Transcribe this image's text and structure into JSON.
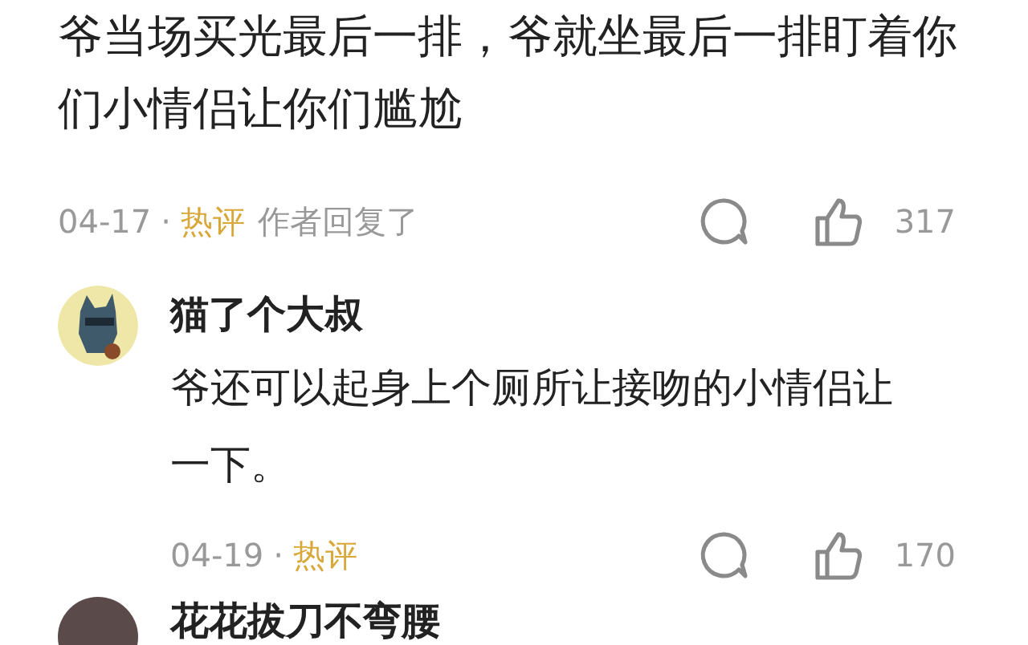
{
  "comments": [
    {
      "text": "爷当场买光最后一排，爷就坐最后一排盯着你们小情侣让你们尴尬",
      "date": "04-17",
      "separator": "·",
      "hot_label": "热评",
      "author_replied": "作者回复了",
      "likes": "317"
    },
    {
      "avatar": {
        "kind": "cartoon"
      },
      "author": "猫了个大叔",
      "text": "爷还可以起身上个厕所让接吻的小情侣让一下。",
      "date": "04-19",
      "separator": "·",
      "hot_label": "热评",
      "likes": "170"
    },
    {
      "avatar": {
        "kind": "photo"
      },
      "author": "花花拔刀不弯腰"
    }
  ]
}
